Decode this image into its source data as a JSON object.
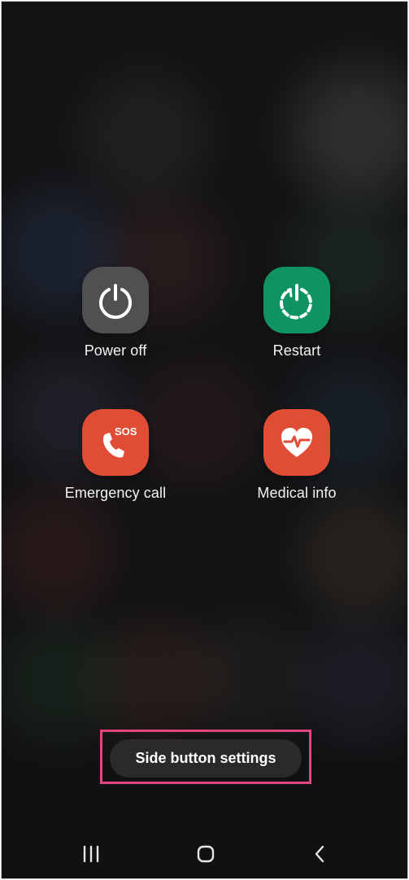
{
  "actions": {
    "power_off": {
      "label": "Power off",
      "icon": "power-icon",
      "color": "#505053"
    },
    "restart": {
      "label": "Restart",
      "icon": "restart-icon",
      "color": "#0f9362"
    },
    "emergency_call": {
      "label": "Emergency call",
      "icon": "sos-phone-icon",
      "badge": "SOS",
      "color": "#e14d34"
    },
    "medical_info": {
      "label": "Medical info",
      "icon": "heart-pulse-icon",
      "color": "#e14d34"
    }
  },
  "side_button": {
    "label": "Side button settings",
    "highlight_color": "#e3447f"
  },
  "nav": {
    "recents_icon": "recent-apps-icon",
    "home_icon": "home-icon",
    "back_icon": "back-icon"
  }
}
